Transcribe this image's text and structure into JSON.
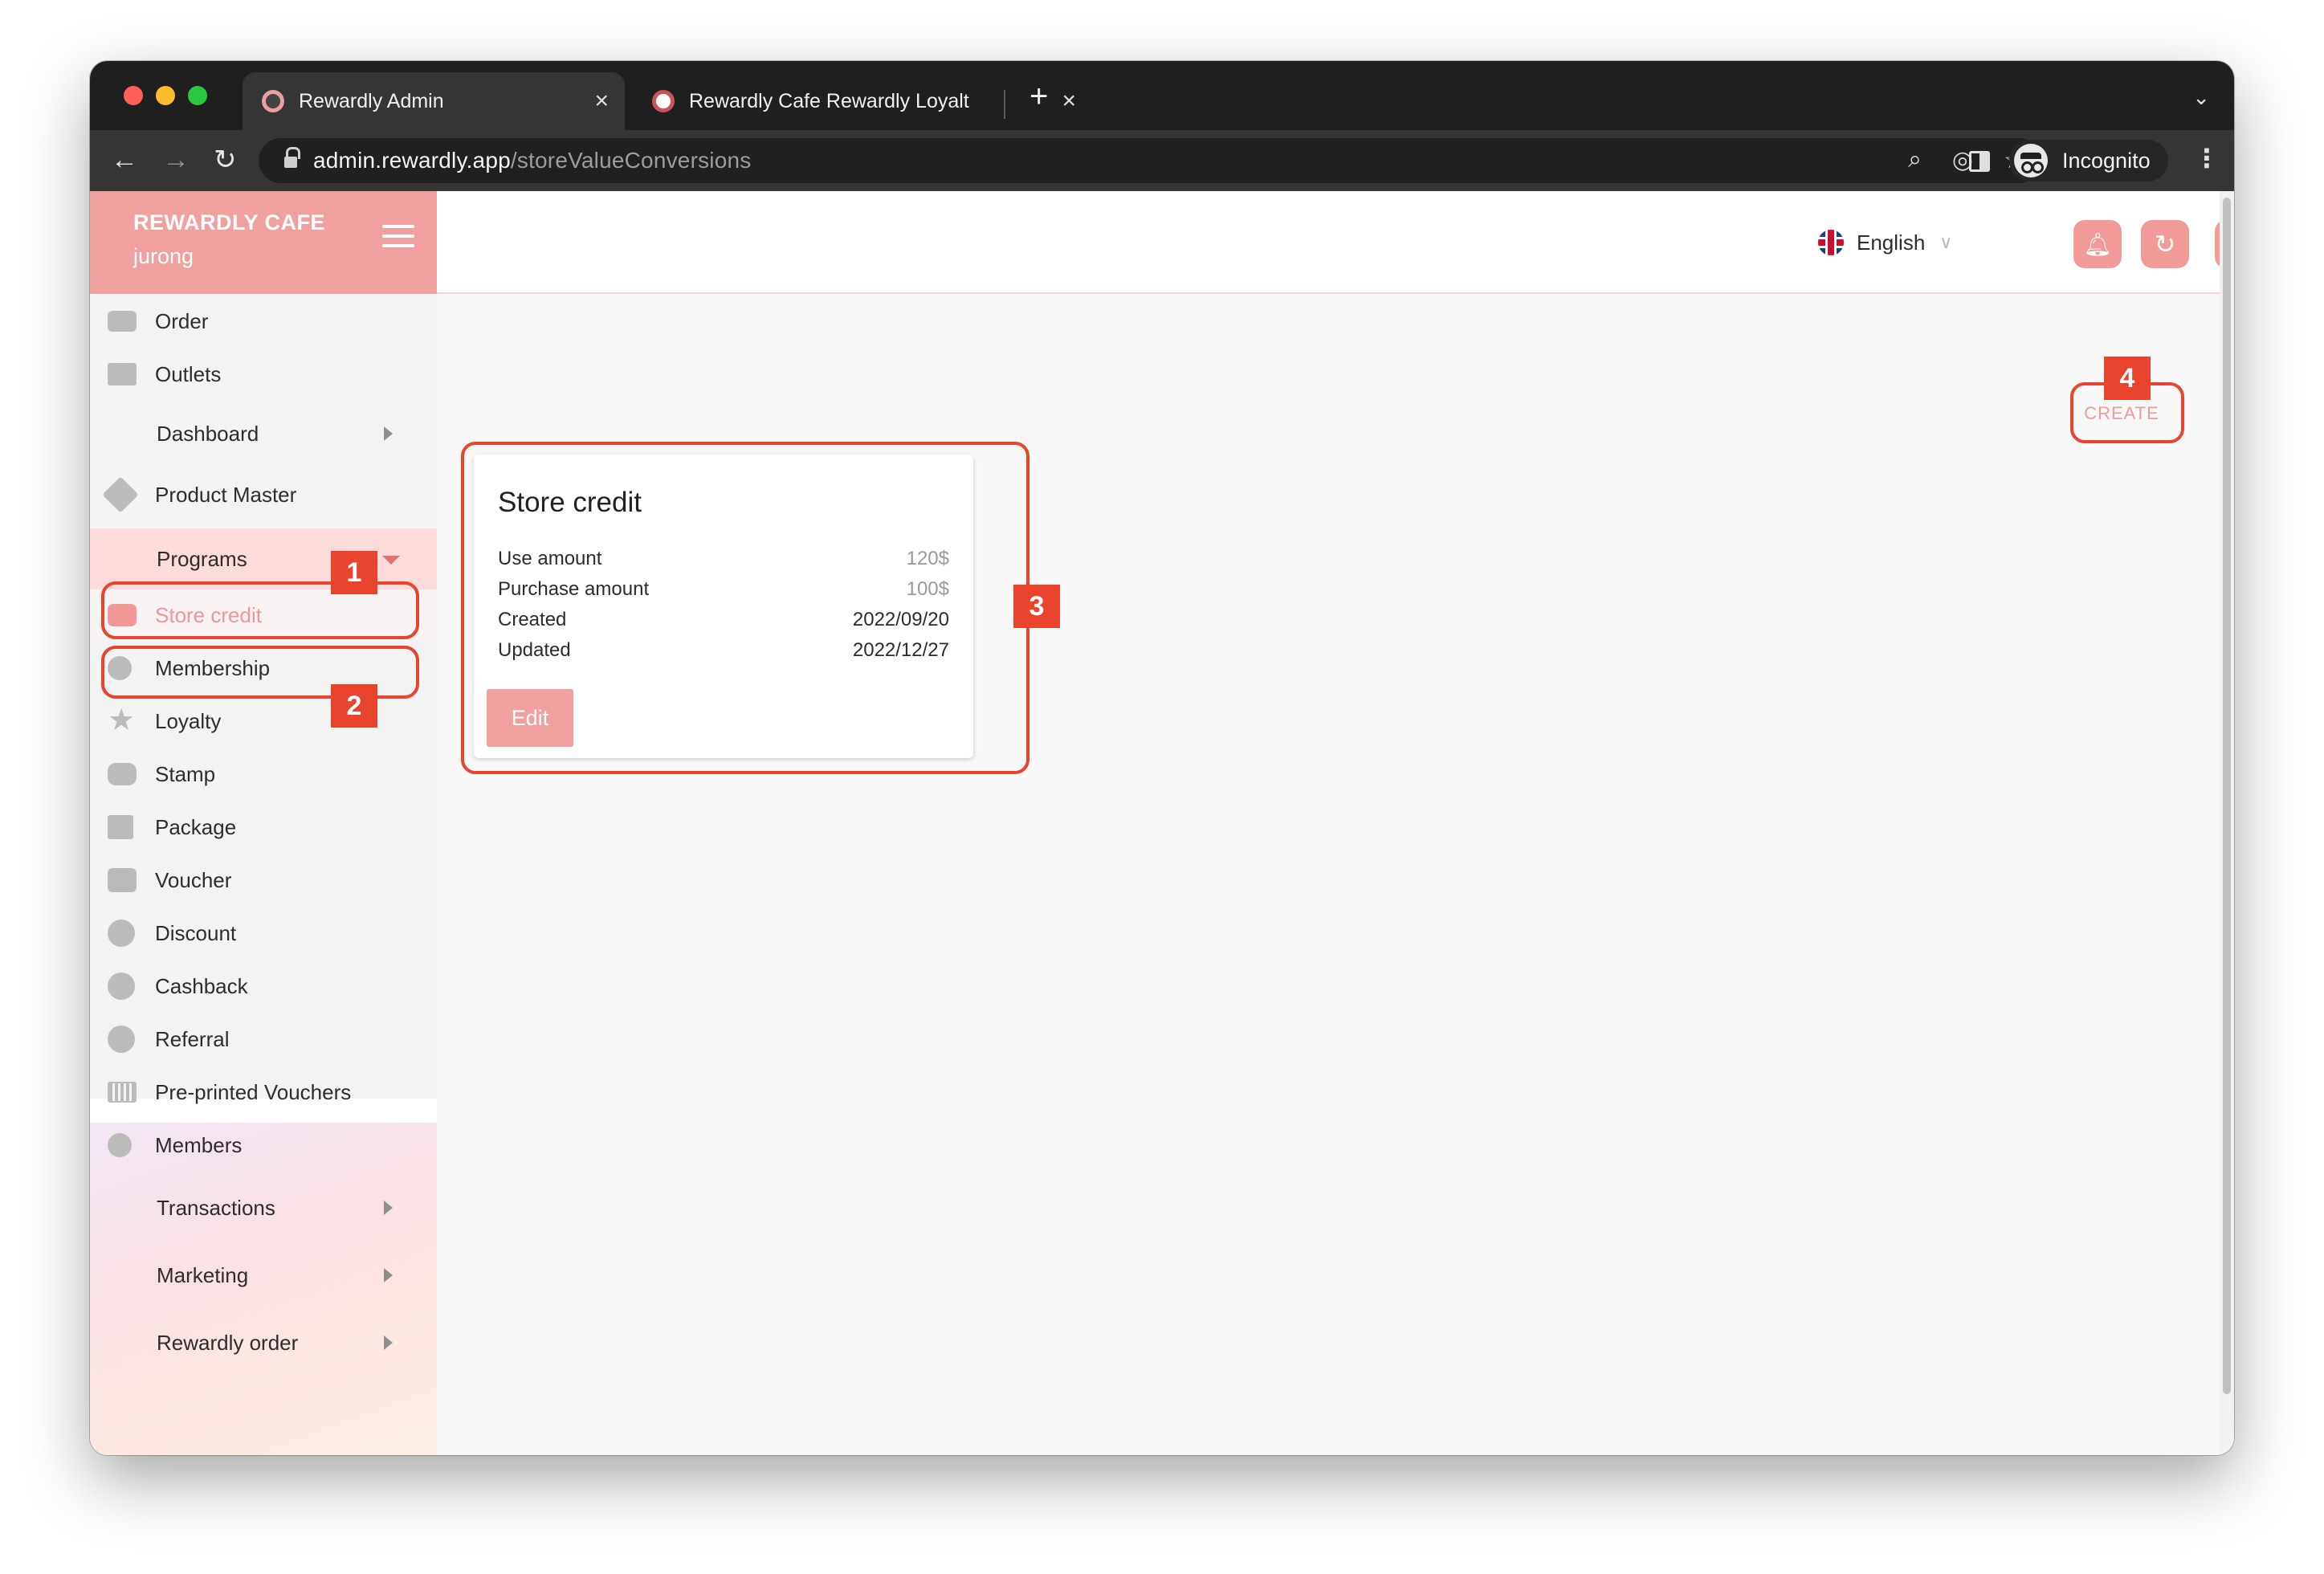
{
  "browser": {
    "tabs": [
      {
        "title": "Rewardly Admin",
        "close": "×"
      },
      {
        "title": "Rewardly Cafe Rewardly Loyalt",
        "close": "×"
      }
    ],
    "new_tab": "+",
    "tab_menu": "⌄",
    "url_host": "admin.rewardly.app",
    "url_path": "/storeValueConversions",
    "incognito_label": "Incognito",
    "nav": {
      "back": "←",
      "forward": "→",
      "reload": "↻"
    }
  },
  "sidebar": {
    "brand_name": "REWARDLY CAFE",
    "outlet": "jurong",
    "items": [
      {
        "label": "Order",
        "icon": "order-icon"
      },
      {
        "label": "Outlets",
        "icon": "outlets-icon"
      },
      {
        "label": "Dashboard",
        "icon": "",
        "has_arrow": true
      },
      {
        "label": "Product Master",
        "icon": "product-master-icon"
      },
      {
        "label": "Programs",
        "icon": "",
        "expanded": true
      },
      {
        "label": "Store credit",
        "icon": "store-credit-icon",
        "active": true
      },
      {
        "label": "Membership",
        "icon": "membership-icon"
      },
      {
        "label": "Loyalty",
        "icon": "star-icon"
      },
      {
        "label": "Stamp",
        "icon": "stamp-icon"
      },
      {
        "label": "Package",
        "icon": "package-icon"
      },
      {
        "label": "Voucher",
        "icon": "voucher-icon"
      },
      {
        "label": "Discount",
        "icon": "discount-icon"
      },
      {
        "label": "Cashback",
        "icon": "cashback-icon"
      },
      {
        "label": "Referral",
        "icon": "referral-icon"
      },
      {
        "label": "Pre-printed Vouchers",
        "icon": "barcode-icon"
      },
      {
        "label": "Members",
        "icon": "members-icon"
      },
      {
        "label": "Transactions",
        "icon": "",
        "has_arrow": true
      },
      {
        "label": "Marketing",
        "icon": "",
        "has_arrow": true
      },
      {
        "label": "Rewardly order",
        "icon": "",
        "has_arrow": true
      }
    ]
  },
  "header": {
    "language": "English",
    "accent": "#f19a98"
  },
  "main": {
    "create_label": "CREATE",
    "card": {
      "title": "Store credit",
      "rows": [
        {
          "label": "Use amount",
          "value": "120$"
        },
        {
          "label": "Purchase amount",
          "value": "100$"
        },
        {
          "label": "Created",
          "value": "2022/09/20"
        },
        {
          "label": "Updated",
          "value": "2022/12/27"
        }
      ],
      "edit_label": "Edit"
    }
  },
  "annotations": [
    "1",
    "2",
    "3",
    "4"
  ],
  "colors": {
    "annotation": "#e8442e",
    "brand": "#f0a19f"
  }
}
